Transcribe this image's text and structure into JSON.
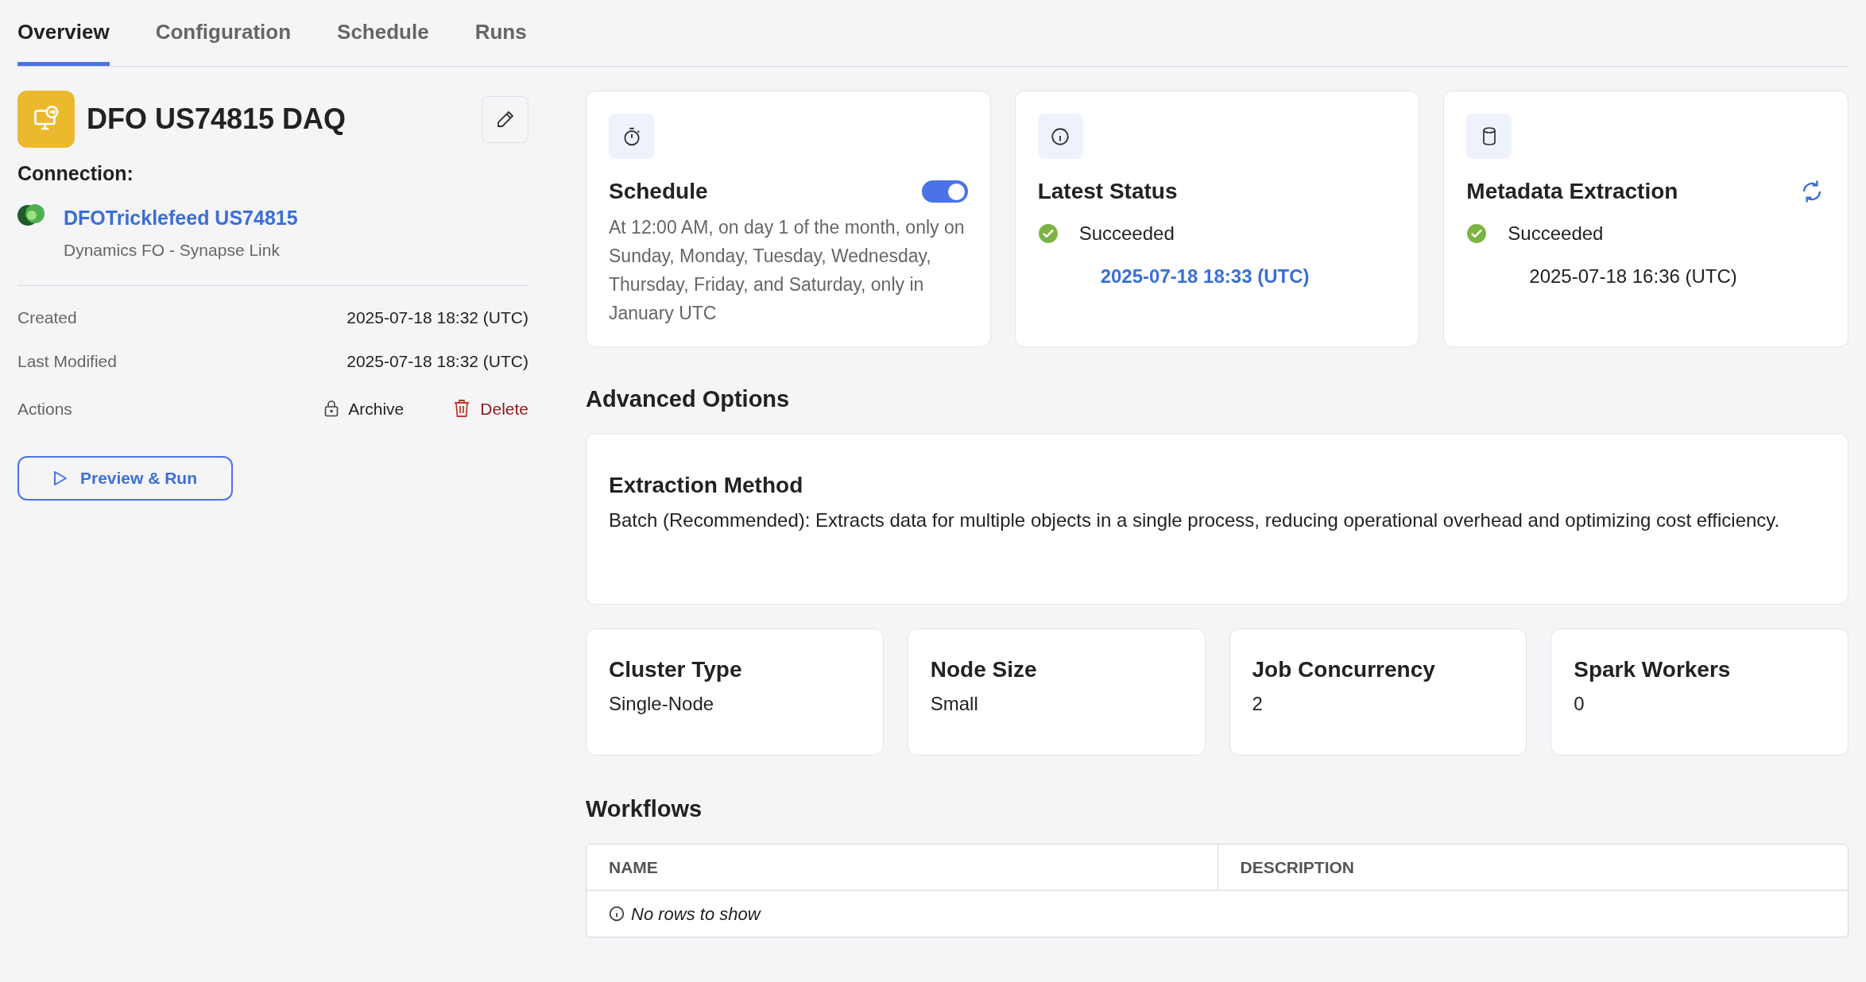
{
  "tabs": [
    {
      "label": "Overview",
      "selected": true
    },
    {
      "label": "Configuration",
      "selected": false
    },
    {
      "label": "Schedule",
      "selected": false
    },
    {
      "label": "Runs",
      "selected": false
    }
  ],
  "pipeline": {
    "title": "DFO US74815 DAQ",
    "connection_label": "Connection:",
    "connection_name": "DFOTricklefeed US74815",
    "connection_type": "Dynamics FO - Synapse Link"
  },
  "details": [
    {
      "label": "Created",
      "value": "2025-07-18 18:32 (UTC)"
    },
    {
      "label": "Last Modified",
      "value": "2025-07-18 18:32 (UTC)"
    }
  ],
  "actions": {
    "label": "Actions",
    "archive": "Archive",
    "delete": "Delete"
  },
  "preview_button": "Preview & Run",
  "schedule_card": {
    "title": "Schedule",
    "on": true,
    "description": "At 12:00 AM, on day 1 of the month, only on Sunday, Monday, Tuesday, Wednesday, Thursday, Friday, and Saturday, only in January UTC"
  },
  "latest_status_card": {
    "title": "Latest Status",
    "status": "Succeeded",
    "time": "2025-07-18 18:33 (UTC)"
  },
  "metadata_card": {
    "title": "Metadata Extraction",
    "status": "Succeeded",
    "time": "2025-07-18 16:36 (UTC)"
  },
  "advanced_options": {
    "heading": "Advanced Options",
    "extraction_title": "Extraction Method",
    "extraction_description": "Batch (Recommended): Extracts data for multiple objects in a single process, reducing operational overhead and optimizing cost efficiency.",
    "settings": [
      {
        "label": "Cluster Type",
        "value": "Single-Node"
      },
      {
        "label": "Node Size",
        "value": "Small"
      },
      {
        "label": "Job Concurrency",
        "value": "2"
      },
      {
        "label": "Spark Workers",
        "value": "0"
      }
    ]
  },
  "workflows": {
    "heading": "Workflows",
    "columns": [
      "NAME",
      "DESCRIPTION"
    ],
    "empty_message": "No rows to show"
  }
}
